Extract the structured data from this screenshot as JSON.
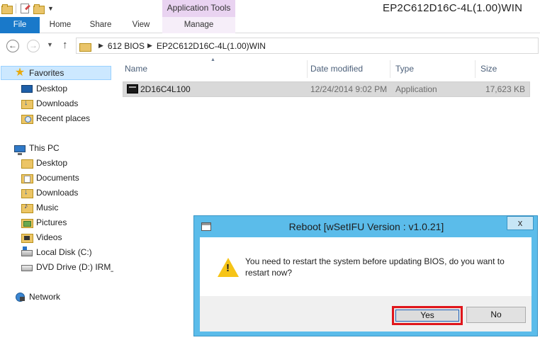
{
  "window": {
    "title": "EP2C612D16C-4L(1.00)WIN",
    "context_tab": "Application Tools"
  },
  "ribbon": {
    "file": "File",
    "home": "Home",
    "share": "Share",
    "view": "View",
    "manage": "Manage"
  },
  "address": {
    "crumbs": [
      "612 BIOS",
      "EP2C612D16C-4L(1.00)WIN"
    ]
  },
  "nav": {
    "favorites": "Favorites",
    "fav_items": [
      "Desktop",
      "Downloads",
      "Recent places"
    ],
    "this_pc": "This PC",
    "pc_items": [
      "Desktop",
      "Documents",
      "Downloads",
      "Music",
      "Pictures",
      "Videos",
      "Local Disk (C:)",
      "DVD Drive (D:) IRM_S"
    ],
    "network": "Network"
  },
  "columns": {
    "name": "Name",
    "date": "Date modified",
    "type": "Type",
    "size": "Size"
  },
  "files": [
    {
      "name": "2D16C4L100",
      "date": "12/24/2014 9:02 PM",
      "type": "Application",
      "size": "17,623 KB"
    }
  ],
  "dialog": {
    "title": "Reboot [wSetIFU Version : v1.0.21]",
    "close": "x",
    "message": "You need to restart the system before updating BIOS, do you want to restart now?",
    "yes": "Yes",
    "no": "No"
  },
  "colors": {
    "file_tab": "#1979ca",
    "dialog_frame": "#5bbcea",
    "highlight": "#e0161c"
  }
}
